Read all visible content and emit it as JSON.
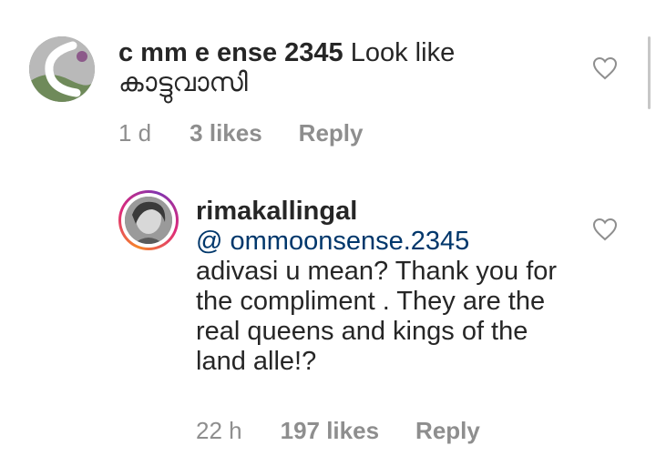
{
  "comments": [
    {
      "username": "c   mm     e   ense   2345",
      "text": "Look like കാട്ടുവാസി",
      "time": "1 d",
      "likes": "3 likes",
      "reply": "Reply"
    },
    {
      "username": "rimakallingal",
      "mention": "@ ommoonsense.2345",
      "text": "adivasi u mean? Thank you for the compliment . They are the real queens and kings of the land alle!?",
      "time": "22 h",
      "likes": "197 likes",
      "reply": "Reply"
    }
  ],
  "icons": {
    "like": "heart-outline-icon"
  },
  "colors": {
    "text": "#262626",
    "meta": "#8e8e8e",
    "mention": "#00376b"
  }
}
